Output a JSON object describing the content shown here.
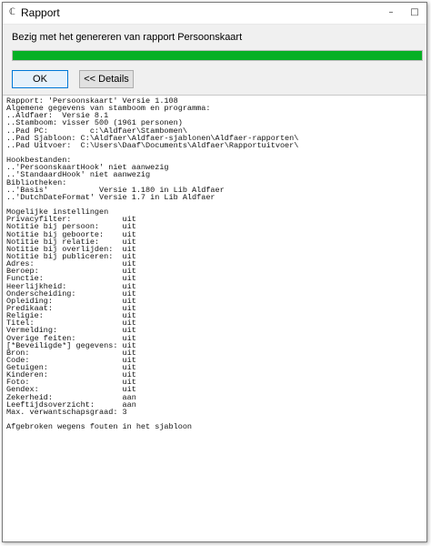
{
  "window": {
    "title": "Rapport",
    "icon": "app-icon",
    "controls": [
      "minimize-icon",
      "maximize-icon"
    ]
  },
  "status": {
    "message": "Bezig met het genereren van rapport Persoonskaart",
    "progress_percent": 100,
    "progress_color": "#06b025"
  },
  "buttons": {
    "ok_label": "OK",
    "details_label": "<< Details"
  },
  "log": {
    "lines": [
      "Rapport: 'Persoonskaart' Versie 1.108",
      "Algemene gegevens van stamboom en programma:",
      "..Aldfaer:  Versie 8.1",
      "..Stamboom: visser 500 (1961 personen)",
      "..Pad PC:         c:\\Aldfaer\\Stambomen\\",
      "..Pad Sjabloon: C:\\Aldfaer\\Aldfaer-sjablonen\\Aldfaer-rapporten\\",
      "..Pad Uitvoer:  C:\\Users\\Daaf\\Documents\\Aldfaer\\Rapportuitvoer\\",
      "",
      "Hookbestanden:",
      "..'PersoonskaartHook' niet aanwezig",
      "..'StandaardHook' niet aanwezig",
      "Bibliotheken:",
      "..'Basis'           Versie 1.180 in Lib Aldfaer",
      "..'DutchDateFormat' Versie 1.7 in Lib Aldfaer",
      "",
      "Mogelijke instellingen",
      "Privacyfilter:           uit",
      "Notitie bij persoon:     uit",
      "Notitie bij geboorte:    uit",
      "Notitie bij relatie:     uit",
      "Notitie bij overlijden:  uit",
      "Notitie bij publiceren:  uit",
      "Adres:                   uit",
      "Beroep:                  uit",
      "Functie:                 uit",
      "Heerlijkheid:            uit",
      "Onderscheiding:          uit",
      "Opleiding:               uit",
      "Predikaat:               uit",
      "Religie:                 uit",
      "Titel:                   uit",
      "Vermelding:              uit",
      "Overige feiten:          uit",
      "[*Beveiligde*] gegevens: uit",
      "Bron:                    uit",
      "Code:                    uit",
      "Getuigen:                uit",
      "Kinderen:                uit",
      "Foto:                    uit",
      "Gendex:                  uit",
      "Zekerheid:               aan",
      "Leeftijdsoverzicht:      aan",
      "Max. verwantschapsgraad: 3",
      "",
      "Afgebroken wegens fouten in het sjabloon"
    ]
  }
}
